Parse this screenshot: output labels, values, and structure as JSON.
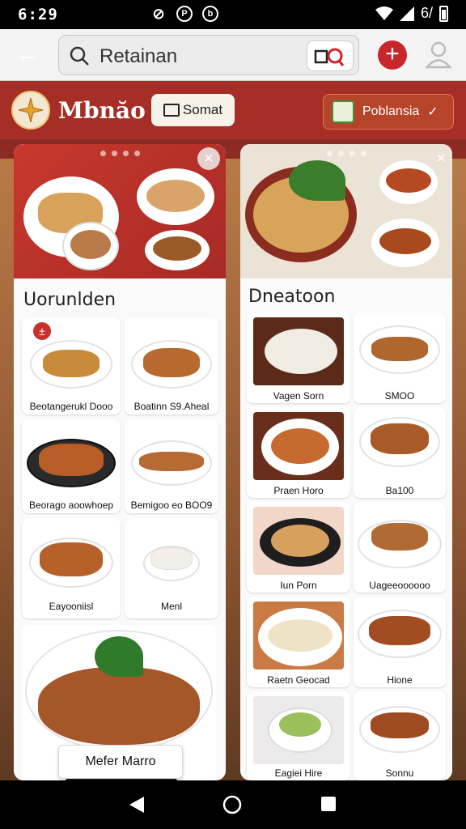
{
  "status_bar": {
    "time": "6:29",
    "icon_p": "P",
    "icon_b": "b",
    "signal_text": "6/"
  },
  "toolbar": {
    "search_value": "Retainan"
  },
  "restaurant": {
    "name": "Mbnăo",
    "sort_label": "Somat",
    "location_label": "Poblansia"
  },
  "left_card": {
    "section_title": "Uorunlden",
    "badge": "±",
    "items": [
      {
        "label": "Beotangerukl Dooo"
      },
      {
        "label": "Boatinn S9.Aheal"
      },
      {
        "label": "Beorago aoowhoep"
      },
      {
        "label": "Bemigoo eo BOO9"
      },
      {
        "label": "Eayooniisl"
      },
      {
        "label": "Menl"
      }
    ],
    "featured_button": "Mefer Marro"
  },
  "right_card": {
    "section_title": "Dneatoon",
    "items": [
      {
        "label": "Vagen Sorn"
      },
      {
        "label": "SMOO"
      },
      {
        "label": "Praen Horo"
      },
      {
        "label": "Ba100"
      },
      {
        "label": "Iun Porn"
      },
      {
        "label": "Uageeoooooo"
      },
      {
        "label": "Raetn Geocad"
      },
      {
        "label": "Hione"
      },
      {
        "label": "Eagiei Hire"
      },
      {
        "label": "Sonnu"
      }
    ]
  },
  "colors": {
    "brand_red": "#a52e27",
    "accent_button": "#c8262a"
  }
}
